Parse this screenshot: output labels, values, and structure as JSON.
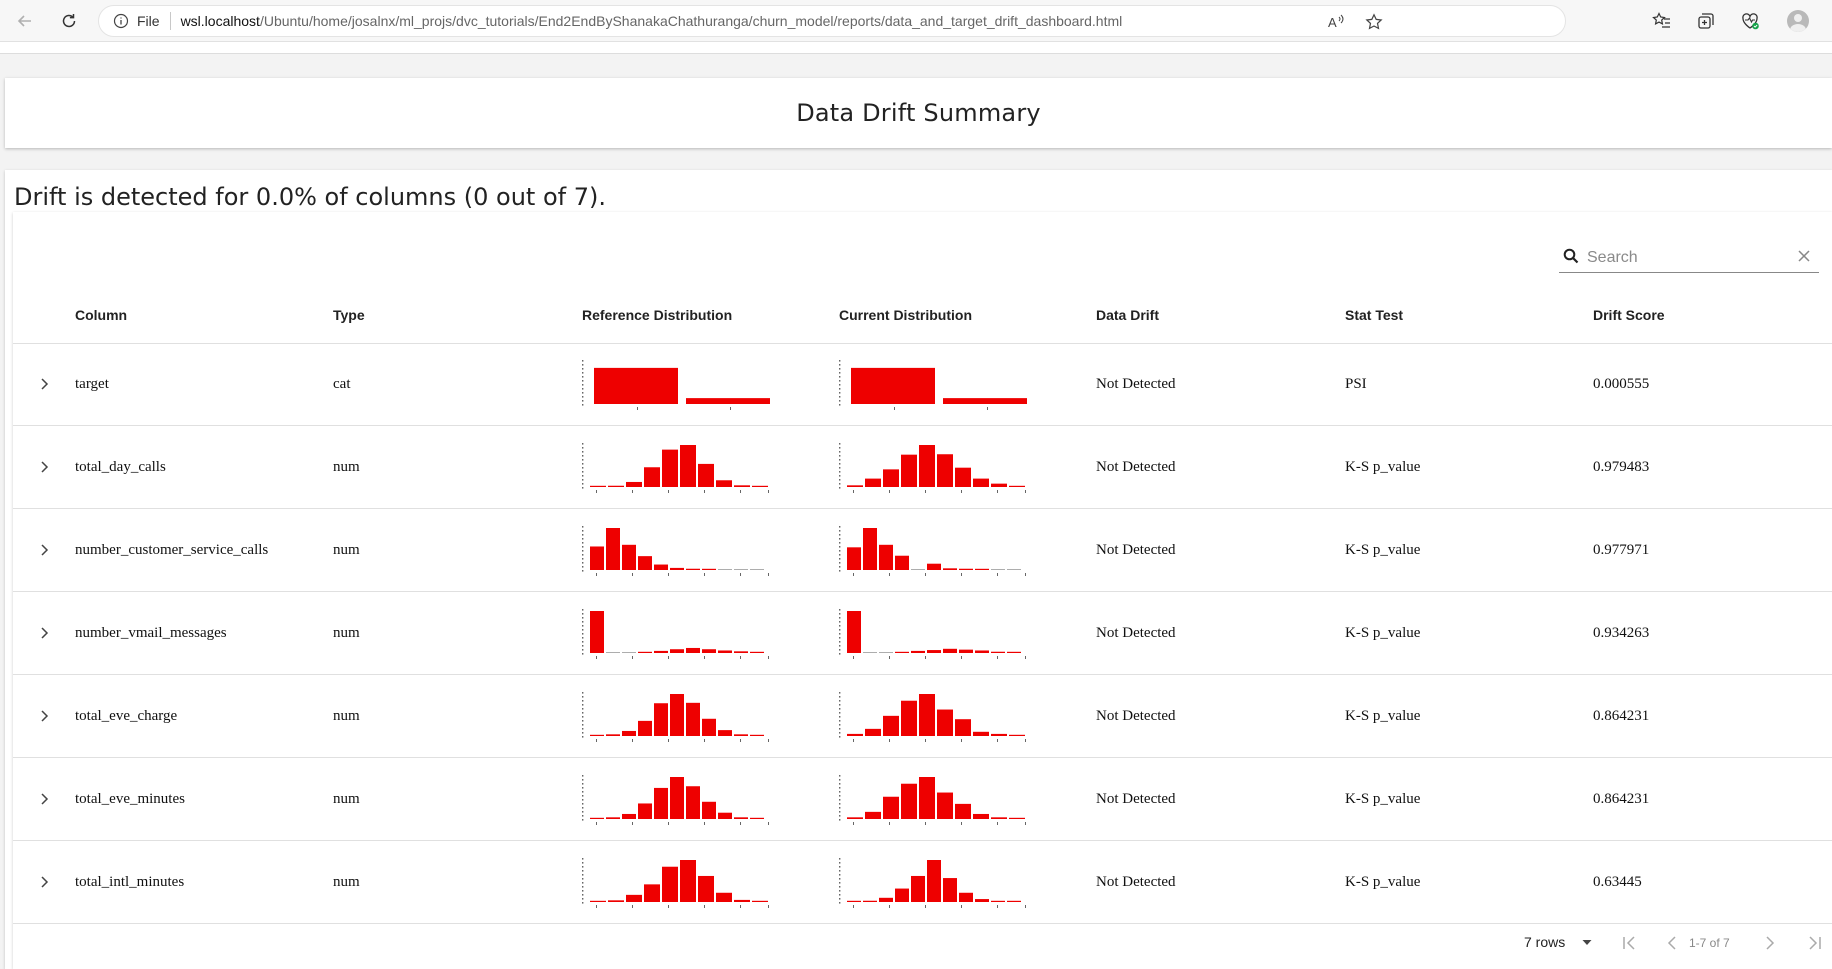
{
  "browser": {
    "file_label": "File",
    "url_host": "wsl.localhost",
    "url_path": "/Ubuntu/home/josalnx/ml_projs/dvc_tutorials/End2EndByShanakaChathuranga/churn_model/reports/data_and_target_drift_dashboard.html"
  },
  "page": {
    "summary_title": "Data Drift Summary",
    "drift_text": "Drift is detected for 0.0% of columns (0 out of 7)."
  },
  "search": {
    "placeholder": "Search"
  },
  "table": {
    "headers": {
      "column": "Column",
      "type": "Type",
      "reference": "Reference Distribution",
      "current": "Current Distribution",
      "data_drift": "Data Drift",
      "stat_test": "Stat Test",
      "drift_score": "Drift Score"
    },
    "rows": [
      {
        "column": "target",
        "type": "cat",
        "data_drift": "Not Detected",
        "stat_test": "PSI",
        "drift_score": "0.000555",
        "ref": [
          0.86,
          0.14
        ],
        "cur": [
          0.86,
          0.14
        ]
      },
      {
        "column": "total_day_calls",
        "type": "num",
        "data_drift": "Not Detected",
        "stat_test": "K-S p_value",
        "drift_score": "0.979483",
        "ref": [
          0.01,
          0.03,
          0.12,
          0.47,
          0.89,
          1.0,
          0.55,
          0.16,
          0.04,
          0.01
        ],
        "cur": [
          0.04,
          0.2,
          0.42,
          0.77,
          1.0,
          0.78,
          0.46,
          0.2,
          0.08,
          0.02
        ]
      },
      {
        "column": "number_customer_service_calls",
        "type": "num",
        "data_drift": "Not Detected",
        "stat_test": "K-S p_value",
        "drift_score": "0.977971",
        "ref": [
          0.56,
          1.0,
          0.6,
          0.33,
          0.13,
          0.05,
          0.03,
          0.01,
          0,
          0,
          0
        ],
        "cur": [
          0.54,
          1.0,
          0.6,
          0.34,
          0,
          0.15,
          0.04,
          0.03,
          0.01,
          0,
          0
        ]
      },
      {
        "column": "number_vmail_messages",
        "type": "num",
        "data_drift": "Not Detected",
        "stat_test": "K-S p_value",
        "drift_score": "0.934263",
        "ref": [
          1.0,
          0,
          0,
          0.01,
          0.05,
          0.09,
          0.12,
          0.09,
          0.06,
          0.04,
          0.02
        ],
        "cur": [
          1.0,
          0,
          0,
          0.01,
          0.05,
          0.07,
          0.1,
          0.08,
          0.06,
          0.03,
          0.02
        ]
      },
      {
        "column": "total_eve_charge",
        "type": "num",
        "data_drift": "Not Detected",
        "stat_test": "K-S p_value",
        "drift_score": "0.864231",
        "ref": [
          0.01,
          0.04,
          0.12,
          0.36,
          0.78,
          1.0,
          0.79,
          0.41,
          0.14,
          0.04,
          0.01
        ],
        "cur": [
          0.05,
          0.17,
          0.48,
          0.84,
          1.0,
          0.63,
          0.4,
          0.1,
          0.05,
          0.01
        ]
      },
      {
        "column": "total_eve_minutes",
        "type": "num",
        "data_drift": "Not Detected",
        "stat_test": "K-S p_value",
        "drift_score": "0.864231",
        "ref": [
          0.02,
          0.04,
          0.12,
          0.37,
          0.74,
          1.0,
          0.78,
          0.41,
          0.15,
          0.04,
          0.01
        ],
        "cur": [
          0.04,
          0.17,
          0.53,
          0.84,
          1.0,
          0.63,
          0.36,
          0.12,
          0.04,
          0.01
        ]
      },
      {
        "column": "total_intl_minutes",
        "type": "num",
        "data_drift": "Not Detected",
        "stat_test": "K-S p_value",
        "drift_score": "0.63445",
        "ref": [
          0.01,
          0.04,
          0.17,
          0.42,
          0.84,
          1.0,
          0.62,
          0.22,
          0.05,
          0.01
        ],
        "cur": [
          0.01,
          0.03,
          0.1,
          0.32,
          0.62,
          1.0,
          0.57,
          0.22,
          0.07,
          0.02,
          0.01
        ]
      }
    ]
  },
  "footer": {
    "rows_per_page": "7 rows",
    "range": "1-7 of 7"
  },
  "colors": {
    "bar": "#ee0000",
    "accent": "#0067c0"
  }
}
